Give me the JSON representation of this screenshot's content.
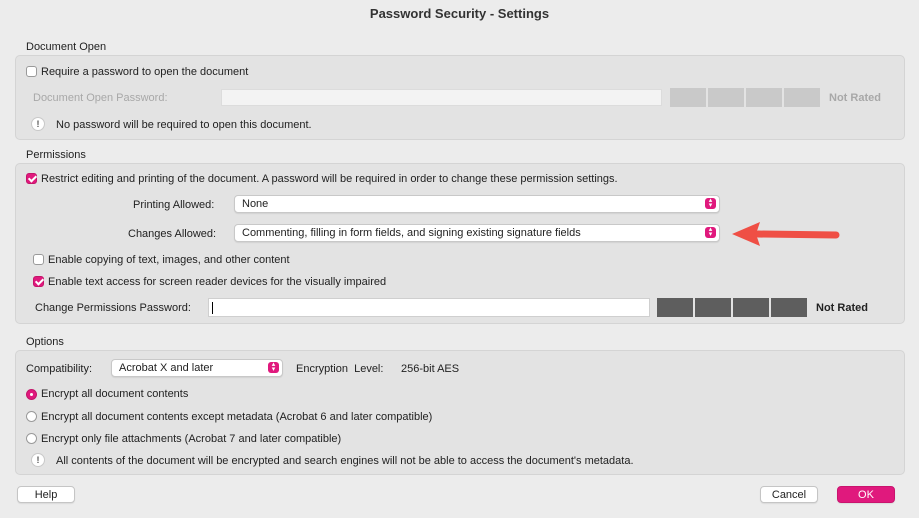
{
  "window": {
    "title": "Password Security - Settings"
  },
  "document_open": {
    "section_label": "Document Open",
    "require_password_label": "Require a password to open the document",
    "require_password_checked": false,
    "password_label": "Document Open Password:",
    "password_value": "",
    "strength_label": "Not Rated",
    "info_text": "No password will be required to open this document."
  },
  "permissions": {
    "section_label": "Permissions",
    "restrict_label": "Restrict editing and printing of the document. A password will be required in order to change these permission settings.",
    "restrict_checked": true,
    "printing_label": "Printing Allowed:",
    "printing_value": "None",
    "changes_label": "Changes Allowed:",
    "changes_value": "Commenting, filling in form fields, and signing existing signature fields",
    "copy_label": "Enable copying of text, images, and other content",
    "copy_checked": false,
    "screenreader_label": "Enable text access for screen reader devices for the visually impaired",
    "screenreader_checked": true,
    "password_label": "Change Permissions Password:",
    "password_value": "",
    "strength_label": "Not Rated"
  },
  "options": {
    "section_label": "Options",
    "compat_label": "Compatibility:",
    "compat_value": "Acrobat X and later",
    "encryption_label": "Encryption  Level:",
    "encryption_value": "256-bit AES",
    "radio_all": "Encrypt all document contents",
    "radio_except_meta": "Encrypt all document contents except metadata (Acrobat 6 and later compatible)",
    "radio_attachments": "Encrypt only file attachments (Acrobat 7 and later compatible)",
    "selected_radio": "radio_all",
    "info_text": "All contents of the document will be encrypted and search engines will not be able to access the document's metadata."
  },
  "footer": {
    "help_label": "Help",
    "cancel_label": "Cancel",
    "ok_label": "OK"
  },
  "colors": {
    "accent": "#e0197d",
    "arrow": "#ef4f45"
  }
}
